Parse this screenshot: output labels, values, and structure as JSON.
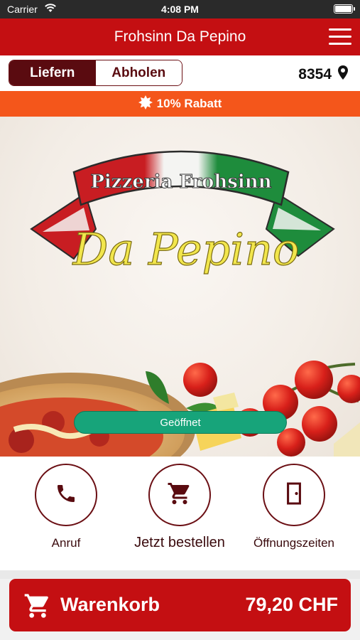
{
  "status_bar": {
    "carrier": "Carrier",
    "time": "4:08 PM"
  },
  "header": {
    "title": "Frohsinn Da Pepino",
    "menu_icon": "hamburger-menu-icon"
  },
  "delivery_mode": {
    "options": [
      {
        "label": "Liefern",
        "active": true
      },
      {
        "label": "Abholen",
        "active": false
      }
    ],
    "postal_code": "8354",
    "location_icon": "map-pin-icon"
  },
  "promo": {
    "text": "10% Rabatt",
    "icon": "badge-icon"
  },
  "hero": {
    "logo": {
      "banner_text": "Pizzeria Frohsinn",
      "script_text": "Da Pepino"
    },
    "status": "Geöffnet"
  },
  "actions": [
    {
      "label": "Anruf",
      "icon": "phone-icon"
    },
    {
      "label": "Jetzt bestellen",
      "icon": "cart-icon"
    },
    {
      "label": "Öffnungszeiten",
      "icon": "door-icon"
    }
  ],
  "cart": {
    "label": "Warenkorb",
    "total": "79,20 CHF",
    "icon": "cart-icon"
  },
  "colors": {
    "brand_red": "#c40f12",
    "dark_maroon": "#5a0b10",
    "promo_orange": "#f4561b",
    "open_green": "#17a47a"
  }
}
